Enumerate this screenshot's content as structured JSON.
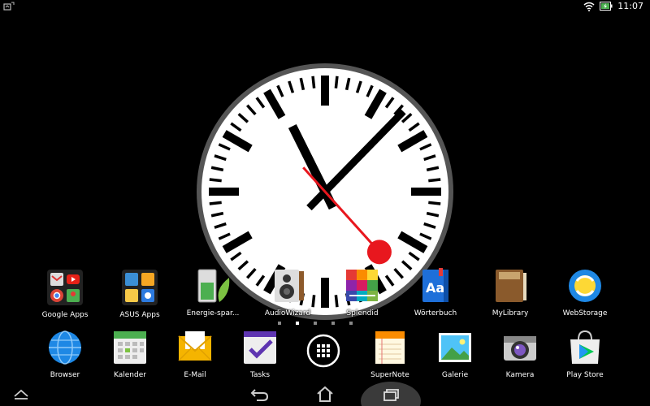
{
  "status_bar": {
    "time": "11:07",
    "icons": [
      "notification-icon",
      "wifi-icon",
      "battery-charging-icon"
    ]
  },
  "clock_widget": {
    "hour": 11,
    "minute": 7,
    "second": 23
  },
  "apps_row1": [
    {
      "label": "Google Apps",
      "icon": "google-apps-folder-icon"
    },
    {
      "label": "ASUS Apps",
      "icon": "asus-apps-folder-icon"
    },
    {
      "label": "Energie-spar...",
      "icon": "power-saver-icon"
    },
    {
      "label": "AudioWizard",
      "icon": "speaker-icon"
    },
    {
      "label": "Splendid",
      "icon": "splendid-icon"
    },
    {
      "label": "Wörterbuch",
      "icon": "dictionary-icon"
    },
    {
      "label": "MyLibrary",
      "icon": "book-icon"
    },
    {
      "label": "WebStorage",
      "icon": "webstorage-icon"
    }
  ],
  "apps_row2": [
    {
      "label": "Browser",
      "icon": "globe-icon"
    },
    {
      "label": "Kalender",
      "icon": "calendar-icon"
    },
    {
      "label": "E-Mail",
      "icon": "mail-icon"
    },
    {
      "label": "Tasks",
      "icon": "tasks-icon"
    },
    {
      "label": "",
      "icon": "app-drawer-icon"
    },
    {
      "label": "SuperNote",
      "icon": "supernote-icon"
    },
    {
      "label": "Galerie",
      "icon": "gallery-icon"
    },
    {
      "label": "Kamera",
      "icon": "camera-icon"
    },
    {
      "label": "Play Store",
      "icon": "play-store-icon"
    }
  ],
  "page_indicator": {
    "pages": 5,
    "current": 2
  },
  "nav_bar": {
    "buttons": [
      "up-arrow-icon",
      "back-icon",
      "home-icon",
      "recents-icon"
    ]
  },
  "colors": {
    "background": "#000000",
    "clock_red": "#e8171e",
    "wifi": "#ffffff",
    "battery": "#4caf50"
  }
}
